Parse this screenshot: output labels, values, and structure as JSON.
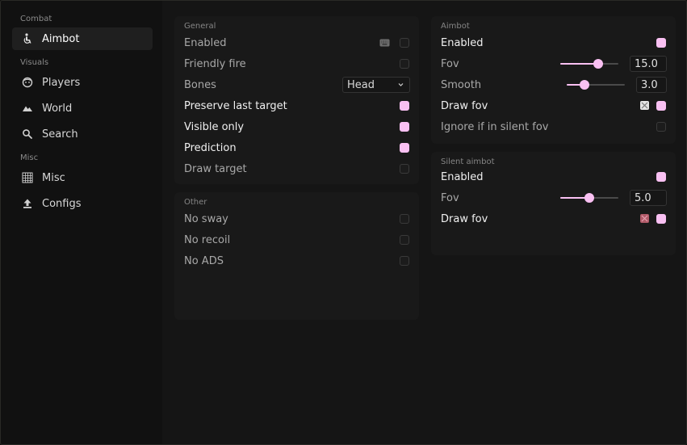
{
  "colors": {
    "accent": "#f9c0f2",
    "swatch_white": "#e6e6e6",
    "swatch_red": "#b05a68"
  },
  "sidebar": {
    "sections": [
      {
        "label": "Combat",
        "items": [
          {
            "label": "Aimbot",
            "icon": "person-icon",
            "active": true
          }
        ]
      },
      {
        "label": "Visuals",
        "items": [
          {
            "label": "Players",
            "icon": "face-icon"
          },
          {
            "label": "World",
            "icon": "mountain-icon"
          },
          {
            "label": "Search",
            "icon": "search-icon"
          }
        ]
      },
      {
        "label": "Misc",
        "items": [
          {
            "label": "Misc",
            "icon": "grid-icon"
          },
          {
            "label": "Configs",
            "icon": "upload-icon"
          }
        ]
      }
    ]
  },
  "general": {
    "title": "General",
    "enabled": {
      "label": "Enabled",
      "checked": false
    },
    "friendly_fire": {
      "label": "Friendly fire",
      "checked": false
    },
    "bones": {
      "label": "Bones",
      "value": "Head"
    },
    "preserve_last_target": {
      "label": "Preserve last target",
      "checked": true
    },
    "visible_only": {
      "label": "Visible only",
      "checked": true
    },
    "prediction": {
      "label": "Prediction",
      "checked": true
    },
    "draw_target": {
      "label": "Draw target",
      "checked": false
    }
  },
  "other": {
    "title": "Other",
    "no_sway": {
      "label": "No sway",
      "checked": false
    },
    "no_recoil": {
      "label": "No recoil",
      "checked": false
    },
    "no_ads": {
      "label": "No ADS",
      "checked": false
    }
  },
  "aimbot": {
    "title": "Aimbot",
    "enabled": {
      "label": "Enabled",
      "checked": true
    },
    "fov": {
      "label": "Fov",
      "value": "15.0",
      "fraction": 0.65
    },
    "smooth": {
      "label": "Smooth",
      "value": "3.0",
      "fraction": 0.3
    },
    "draw_fov": {
      "label": "Draw fov",
      "checked": true
    },
    "ignore_silent": {
      "label": "Ignore if in silent fov",
      "checked": false
    }
  },
  "silent_aimbot": {
    "title": "Silent aimbot",
    "enabled": {
      "label": "Enabled",
      "checked": true
    },
    "fov": {
      "label": "Fov",
      "value": "5.0",
      "fraction": 0.5
    },
    "draw_fov": {
      "label": "Draw fov",
      "checked": true
    }
  }
}
